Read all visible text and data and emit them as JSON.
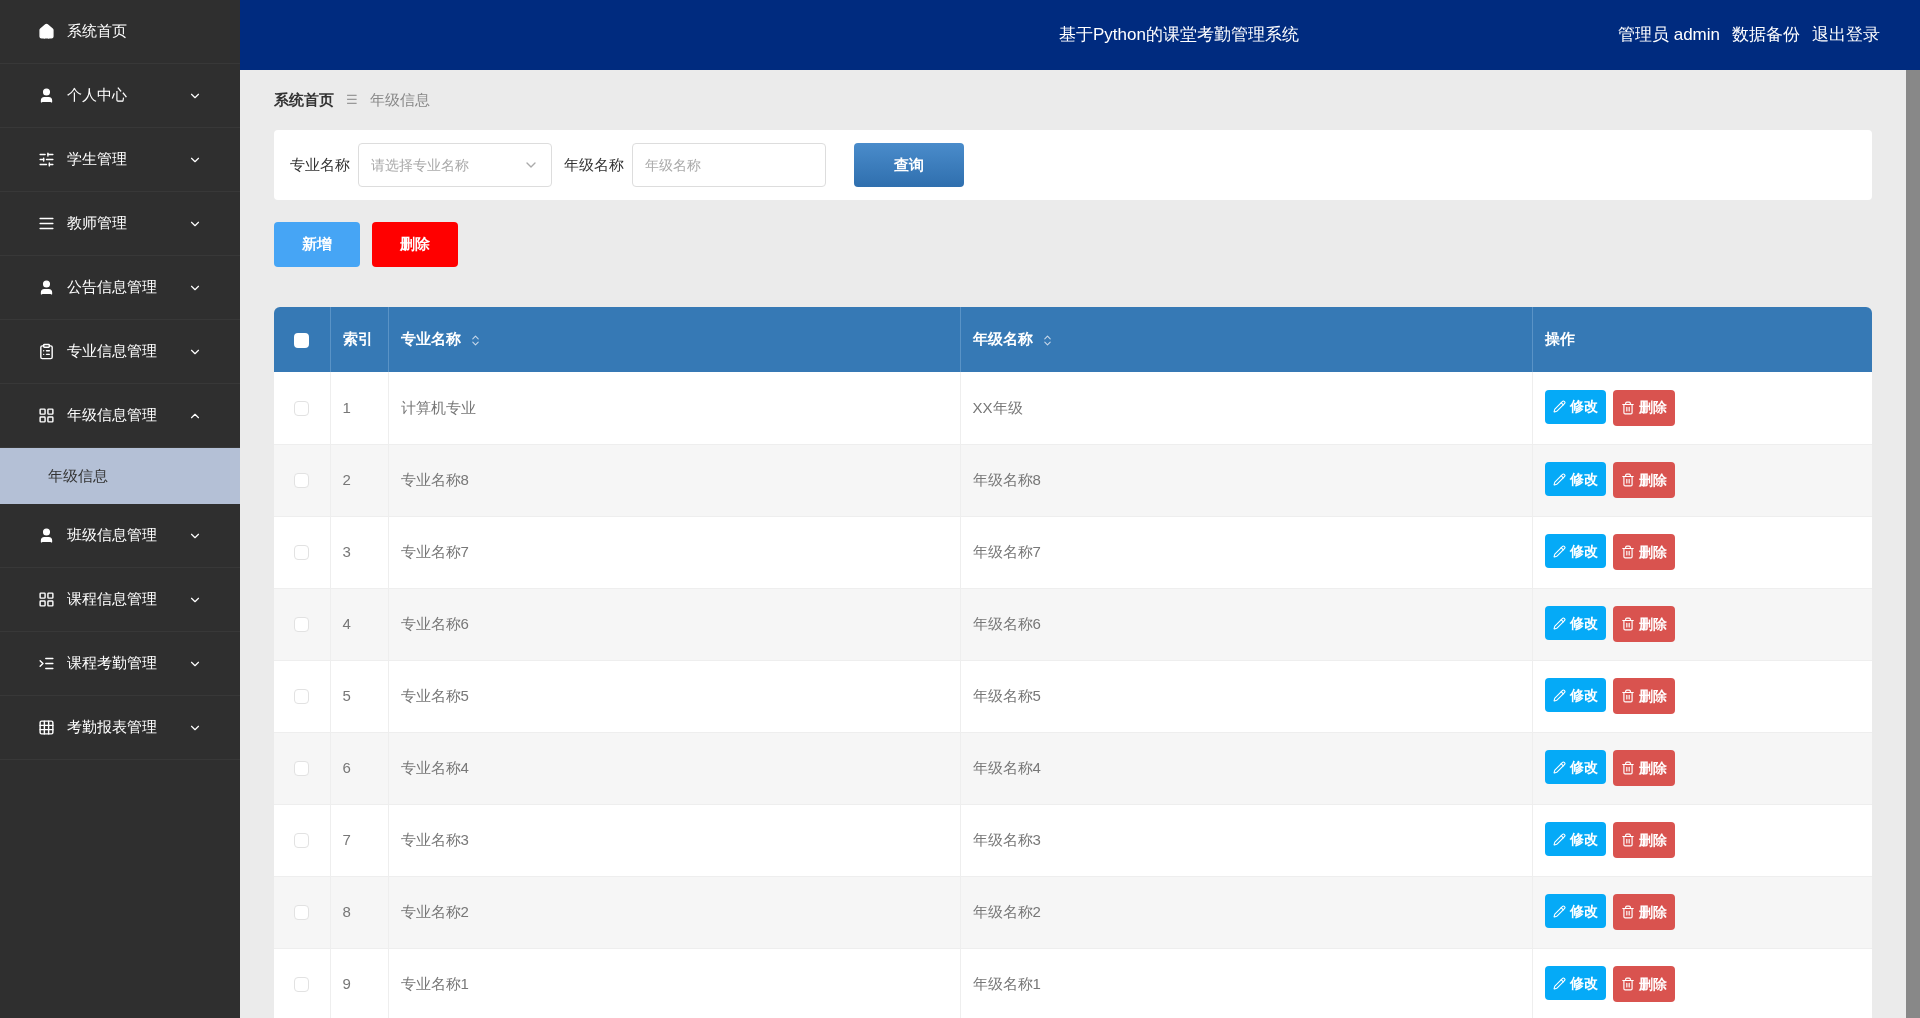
{
  "sidebar": {
    "items": [
      {
        "label": "系统首页"
      },
      {
        "label": "个人中心",
        "expanded": false
      },
      {
        "label": "学生管理",
        "expanded": false
      },
      {
        "label": "教师管理",
        "expanded": false
      },
      {
        "label": "公告信息管理",
        "expanded": false
      },
      {
        "label": "专业信息管理",
        "expanded": false
      },
      {
        "label": "年级信息管理",
        "expanded": true,
        "children": [
          {
            "label": "年级信息",
            "selected": true
          }
        ]
      },
      {
        "label": "班级信息管理",
        "expanded": false
      },
      {
        "label": "课程信息管理",
        "expanded": false
      },
      {
        "label": "课程考勤管理",
        "expanded": false
      },
      {
        "label": "考勤报表管理",
        "expanded": false
      }
    ]
  },
  "header": {
    "title": "基于Python的课堂考勤管理系统",
    "user": "管理员 admin",
    "links": [
      "数据备份",
      "退出登录"
    ]
  },
  "breadcrumb": {
    "items": [
      "系统首页",
      "年级信息"
    ],
    "separator": "☰"
  },
  "search": {
    "fields": [
      {
        "label": "专业名称",
        "kind": "select",
        "placeholder": "请选择专业名称"
      },
      {
        "label": "年级名称",
        "kind": "input",
        "placeholder": "年级名称"
      }
    ],
    "button": "查询"
  },
  "actions": [
    "新增",
    "删除"
  ],
  "table": {
    "all_checked": false,
    "columns": [
      {
        "label": "索引",
        "sortable": false
      },
      {
        "label": "专业名称",
        "sortable": true
      },
      {
        "label": "年级名称",
        "sortable": true
      },
      {
        "label": "操作",
        "sortable": false
      }
    ],
    "rows": [
      {
        "index": "1",
        "major": "计算机专业",
        "grade": "XX年级",
        "checked": false,
        "buttons": [
          "修改",
          "删除"
        ]
      },
      {
        "index": "2",
        "major": "专业名称8",
        "grade": "年级名称8",
        "checked": false,
        "buttons": [
          "修改",
          "删除"
        ]
      },
      {
        "index": "3",
        "major": "专业名称7",
        "grade": "年级名称7",
        "checked": false,
        "buttons": [
          "修改",
          "删除"
        ]
      },
      {
        "index": "4",
        "major": "专业名称6",
        "grade": "年级名称6",
        "checked": false,
        "buttons": [
          "修改",
          "删除"
        ]
      },
      {
        "index": "5",
        "major": "专业名称5",
        "grade": "年级名称5",
        "checked": false,
        "buttons": [
          "修改",
          "删除"
        ]
      },
      {
        "index": "6",
        "major": "专业名称4",
        "grade": "年级名称4",
        "checked": false,
        "buttons": [
          "修改",
          "删除"
        ]
      },
      {
        "index": "7",
        "major": "专业名称3",
        "grade": "年级名称3",
        "checked": false,
        "buttons": [
          "修改",
          "删除"
        ]
      },
      {
        "index": "8",
        "major": "专业名称2",
        "grade": "年级名称2",
        "checked": false,
        "buttons": [
          "修改",
          "删除"
        ]
      },
      {
        "index": "9",
        "major": "专业名称1",
        "grade": "年级名称1",
        "checked": false,
        "buttons": [
          "修改",
          "删除"
        ]
      }
    ]
  }
}
